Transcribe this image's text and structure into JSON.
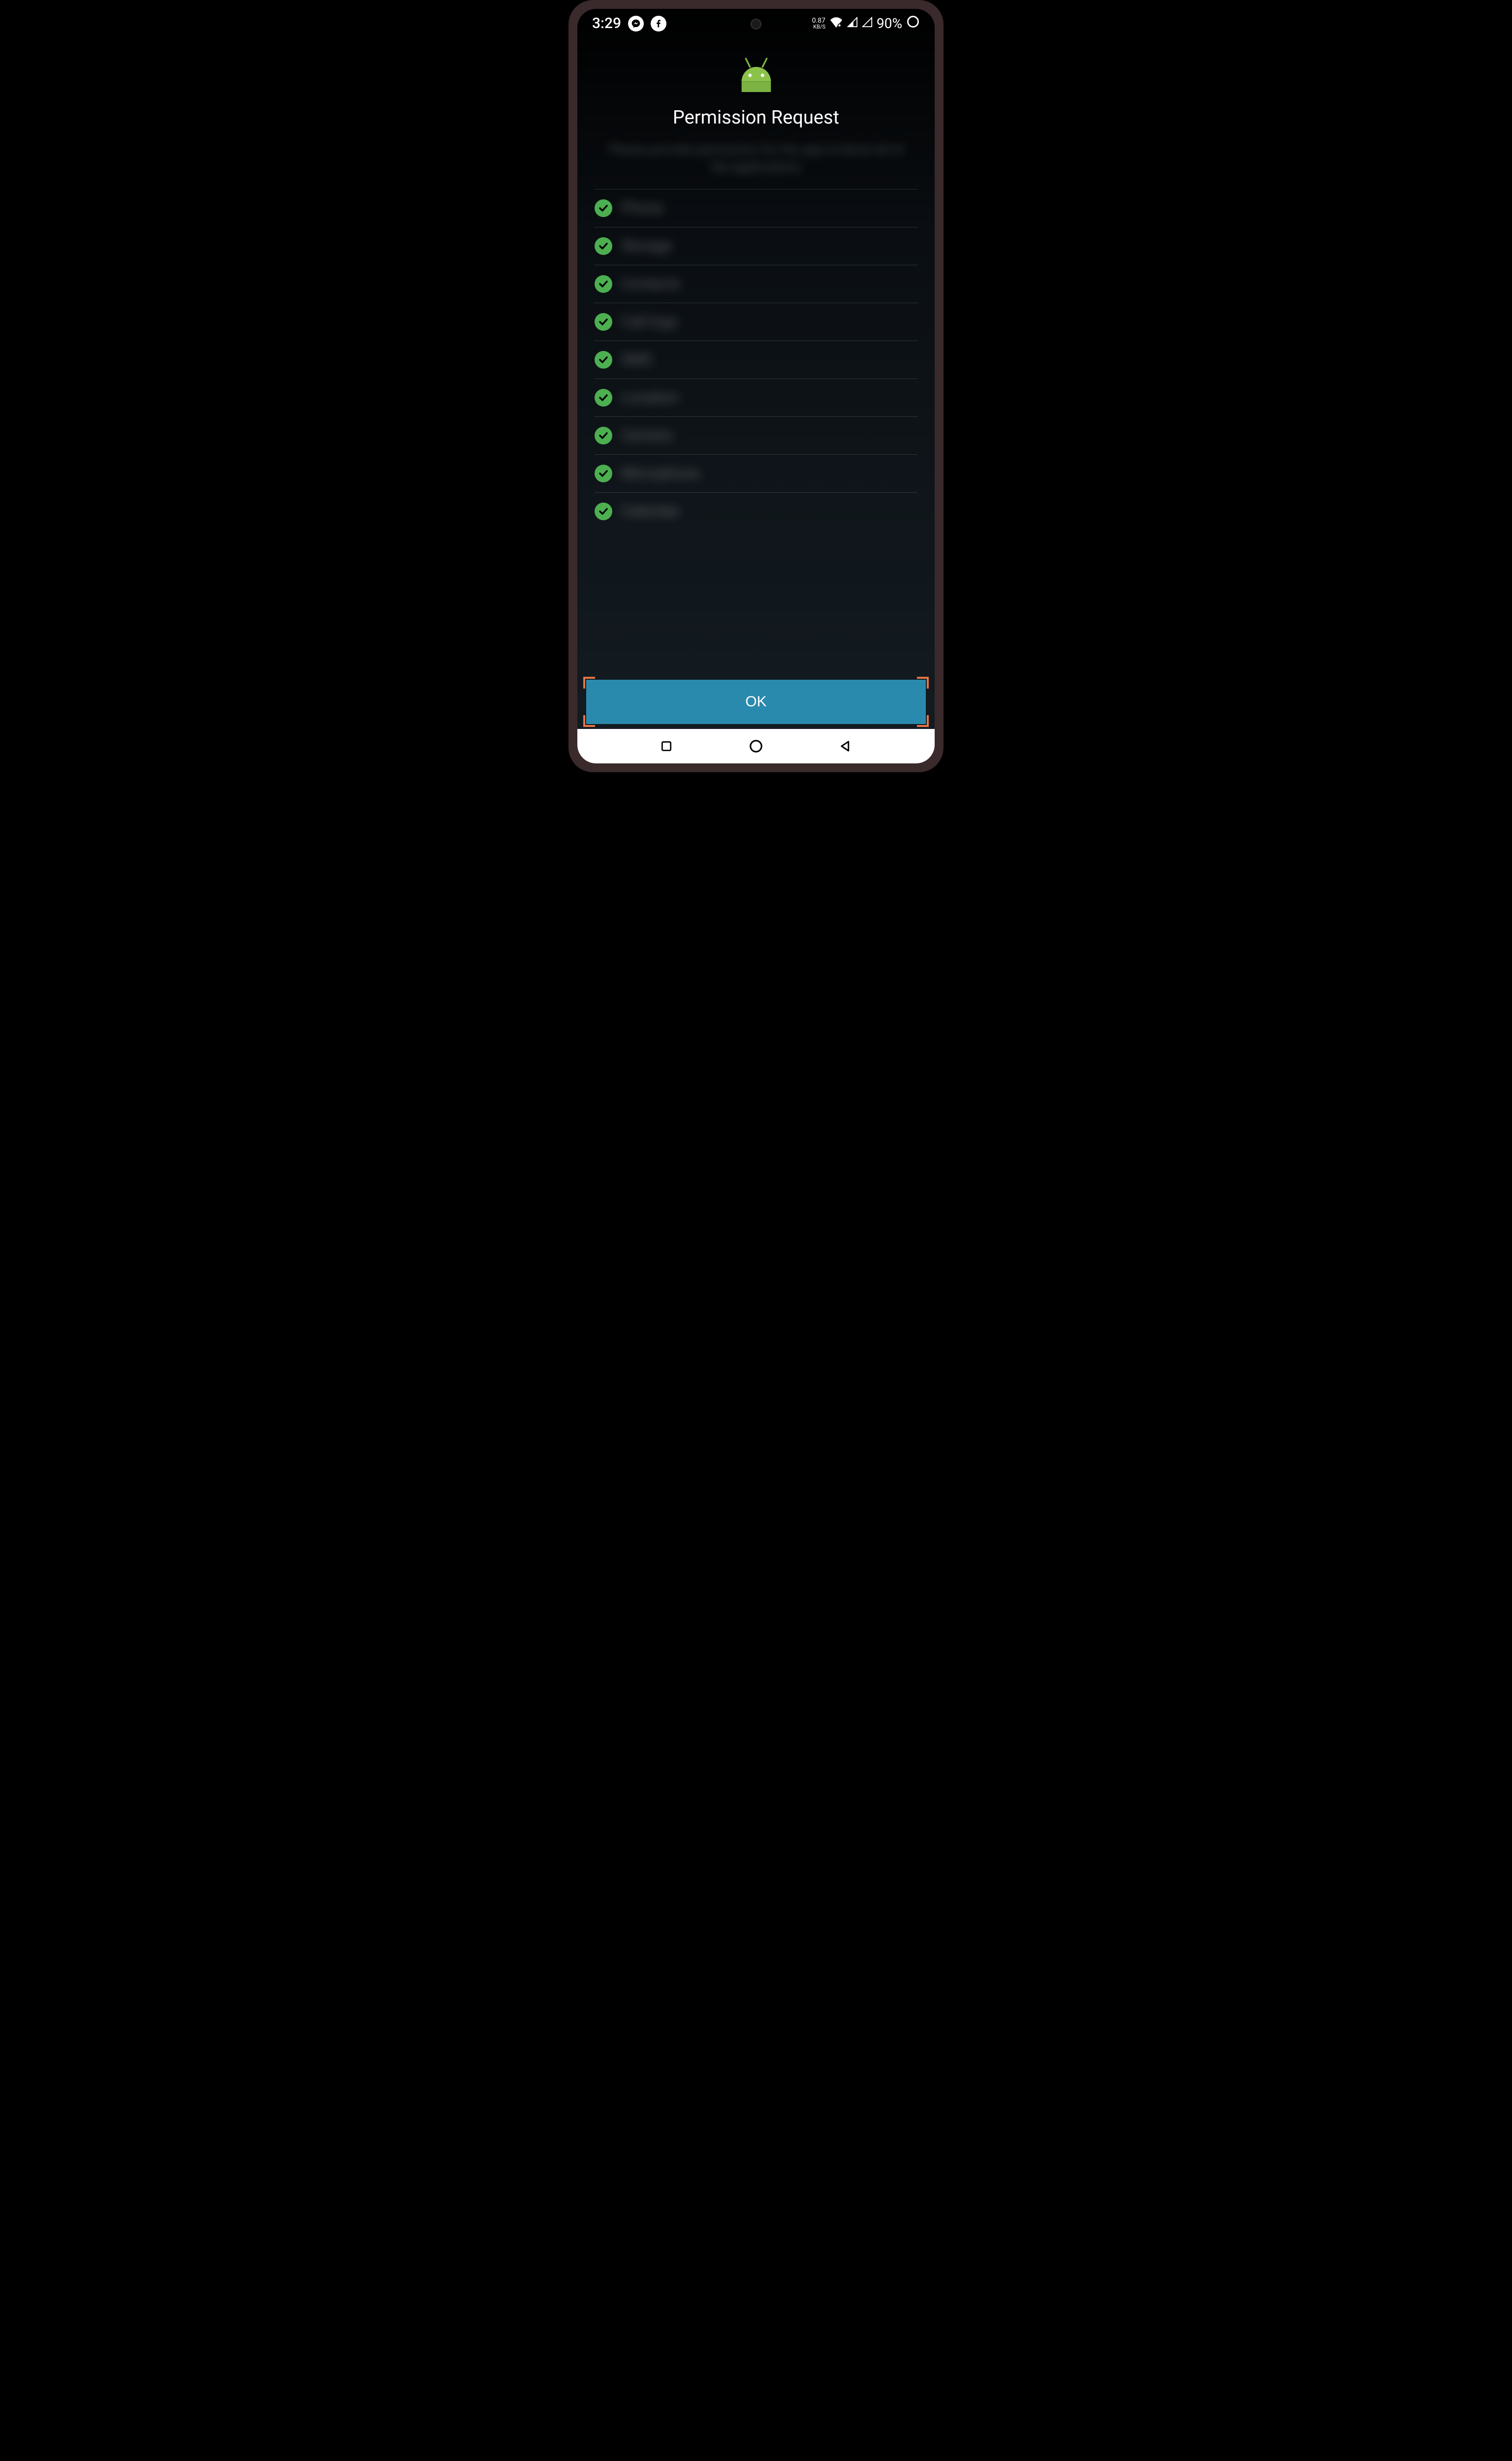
{
  "status_bar": {
    "time": "3:29",
    "network_speed": "0.87",
    "network_speed_unit": "KB/S",
    "battery_percent": "90%"
  },
  "page": {
    "title": "Permission Request",
    "description": "Please provide permission for the app to block all of the applications",
    "ok_button": "OK"
  },
  "permissions": [
    {
      "label": "Phone"
    },
    {
      "label": "Storage"
    },
    {
      "label": "Contacts"
    },
    {
      "label": "Call logs"
    },
    {
      "label": "SMS"
    },
    {
      "label": "Location"
    },
    {
      "label": "Camera"
    },
    {
      "label": "Microphone"
    },
    {
      "label": "Calendar"
    }
  ]
}
